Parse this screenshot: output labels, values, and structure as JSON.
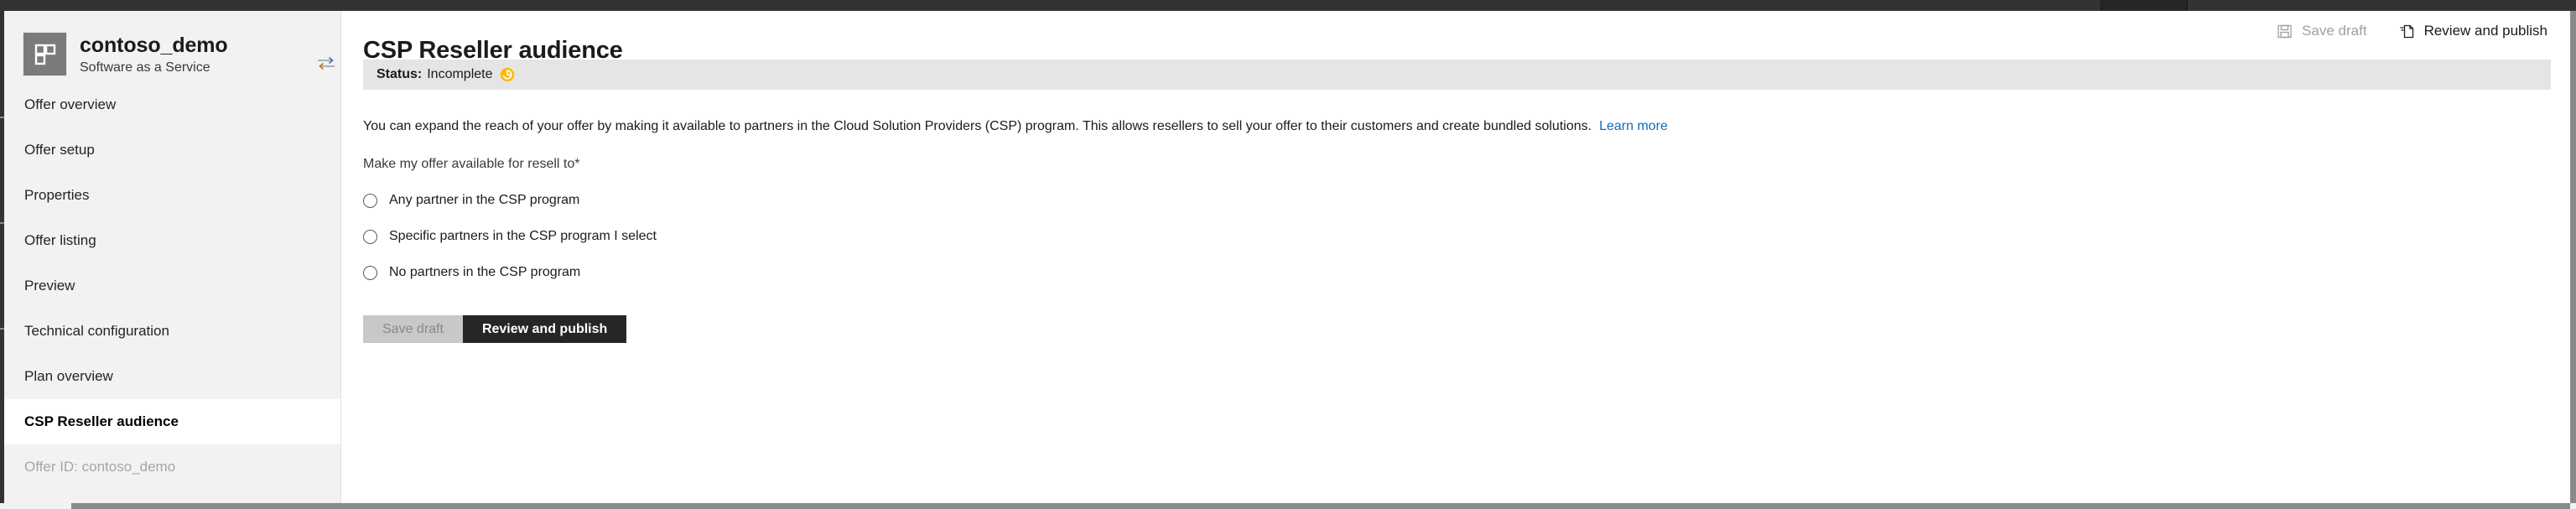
{
  "chrome": {
    "bar_color": "#333333",
    "active_tab_color": "#262626"
  },
  "sidebar": {
    "offer": {
      "name": "contoso_demo",
      "subtitle": "Software as a Service",
      "logo_icon": "grid-blocks-icon",
      "swap_icon": "swap-horizontal-icon"
    },
    "items": [
      {
        "label": "Offer overview",
        "selected": false
      },
      {
        "label": "Offer setup",
        "selected": false
      },
      {
        "label": "Properties",
        "selected": false
      },
      {
        "label": "Offer listing",
        "selected": false
      },
      {
        "label": "Preview",
        "selected": false
      },
      {
        "label": "Technical configuration",
        "selected": false
      },
      {
        "label": "Plan overview",
        "selected": false
      },
      {
        "label": "CSP Reseller audience",
        "selected": true
      }
    ],
    "footer": {
      "offer_id_label": "Offer ID: contoso_demo"
    }
  },
  "header": {
    "page_title": "CSP Reseller audience",
    "commands": [
      {
        "label": "Save draft",
        "icon": "save-floppy-icon",
        "enabled": false
      },
      {
        "label": "Review and publish",
        "icon": "publish-document-icon",
        "enabled": true
      }
    ]
  },
  "status": {
    "label": "Status:",
    "value": "Incomplete",
    "icon": "clock-pending-icon",
    "icon_color": "#ffb900",
    "bar_color": "#e5e5e5"
  },
  "main": {
    "intro_text": "You can expand the reach of your offer by making it available to partners in the Cloud Solution Providers (CSP) program. This allows resellers to sell your offer to their customers and create bundled solutions.",
    "learn_more_label": "Learn more",
    "field_label": "Make my offer available for resell to",
    "required_marker": "*",
    "radio_options": [
      {
        "label": "Any partner in the CSP program",
        "checked": false
      },
      {
        "label": "Specific partners in the CSP program I select",
        "checked": false
      },
      {
        "label": "No partners in the CSP program",
        "checked": false
      }
    ],
    "actions": {
      "save_draft_label": "Save draft",
      "review_publish_label": "Review and publish"
    }
  },
  "colors": {
    "link": "#0f6cbd",
    "primary_button": "#262626",
    "sidebar_bg": "#f2f2f2",
    "status_icon": "#ffb900"
  }
}
